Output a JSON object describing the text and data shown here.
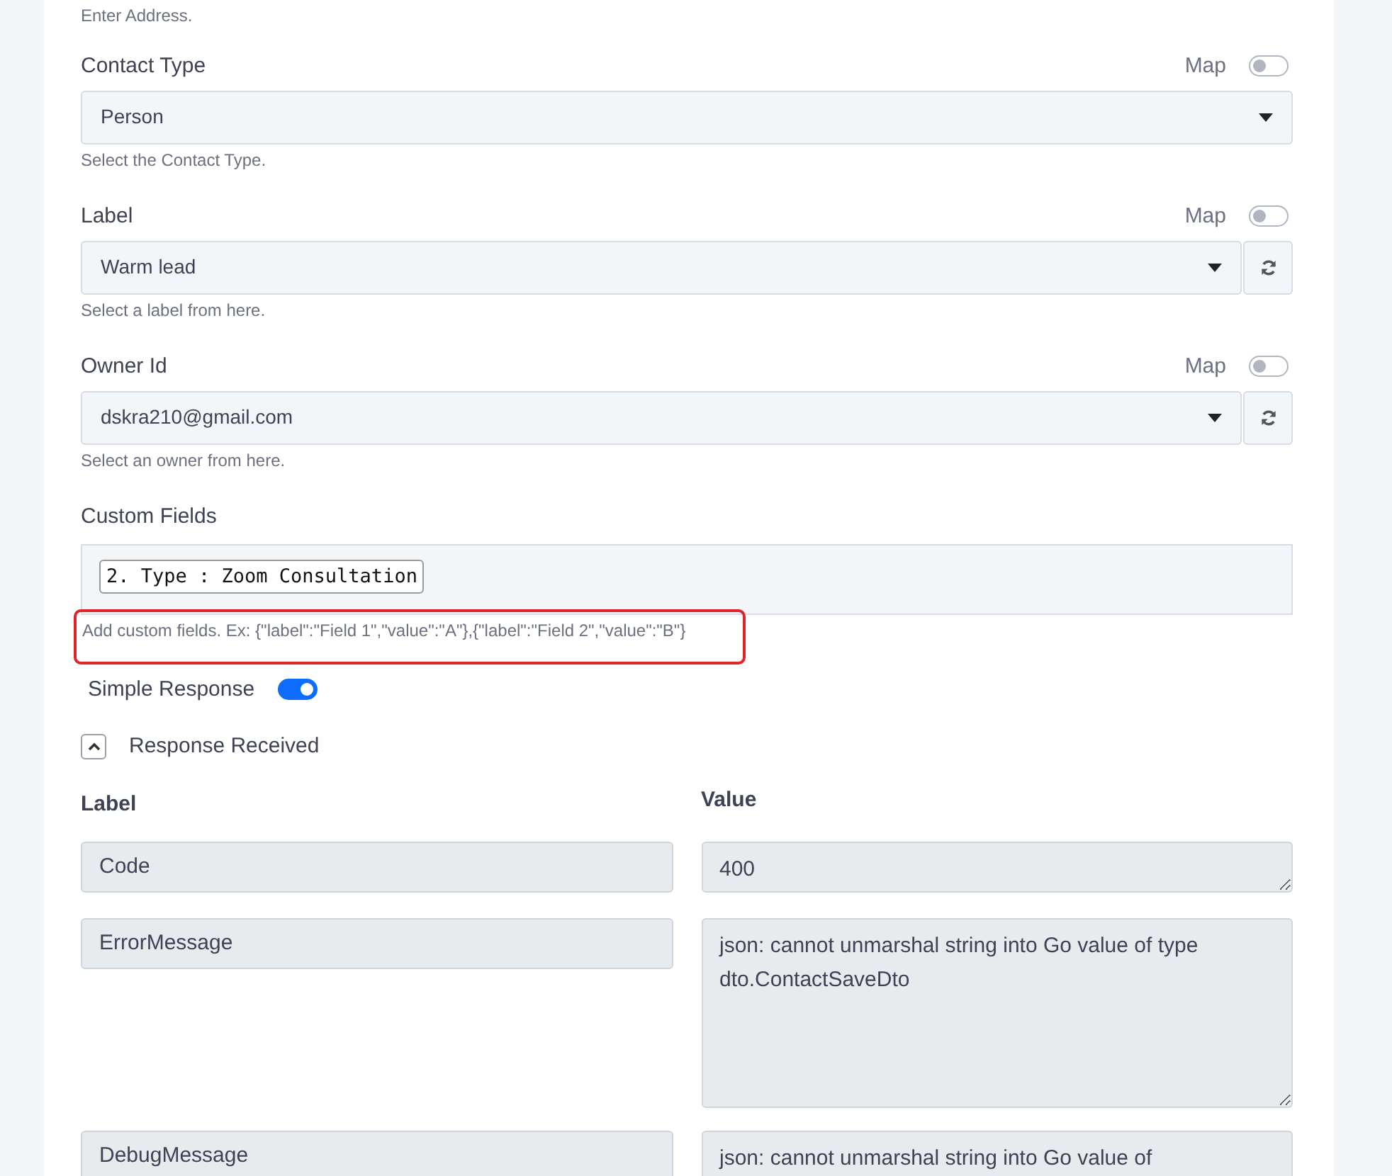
{
  "top_help": "Enter Address.",
  "fields": [
    {
      "label": "Contact Type",
      "map_label": "Map",
      "map_on": false,
      "value": "Person",
      "help": "Select the Contact Type.",
      "refresh": false
    },
    {
      "label": "Label",
      "map_label": "Map",
      "map_on": false,
      "value": "Warm lead",
      "help": "Select a label from here.",
      "refresh": true
    },
    {
      "label": "Owner Id",
      "map_label": "Map",
      "map_on": false,
      "value": "dskra210@gmail.com",
      "help": "Select an owner from here.",
      "refresh": true
    }
  ],
  "custom_fields": {
    "label": "Custom Fields",
    "tags": [
      "2. Type : Zoom Consultation"
    ],
    "help": "Add custom fields. Ex: {\"label\":\"Field 1\",\"value\":\"A\"},{\"label\":\"Field 2\",\"value\":\"B\"}",
    "highlighted": true
  },
  "simple_response": {
    "label": "Simple Response",
    "on": true
  },
  "response": {
    "title": "Response Received",
    "expanded": true,
    "columns": [
      "Label",
      "Value"
    ],
    "rows": [
      {
        "label": "Code",
        "value": "400",
        "kind": "short"
      },
      {
        "label": "ErrorMessage",
        "value": "json: cannot unmarshal string into Go value of type dto.ContactSaveDto",
        "kind": "tall"
      },
      {
        "label": "DebugMessage",
        "value": "json: cannot unmarshal string into Go value of",
        "kind": "scroll"
      }
    ]
  }
}
